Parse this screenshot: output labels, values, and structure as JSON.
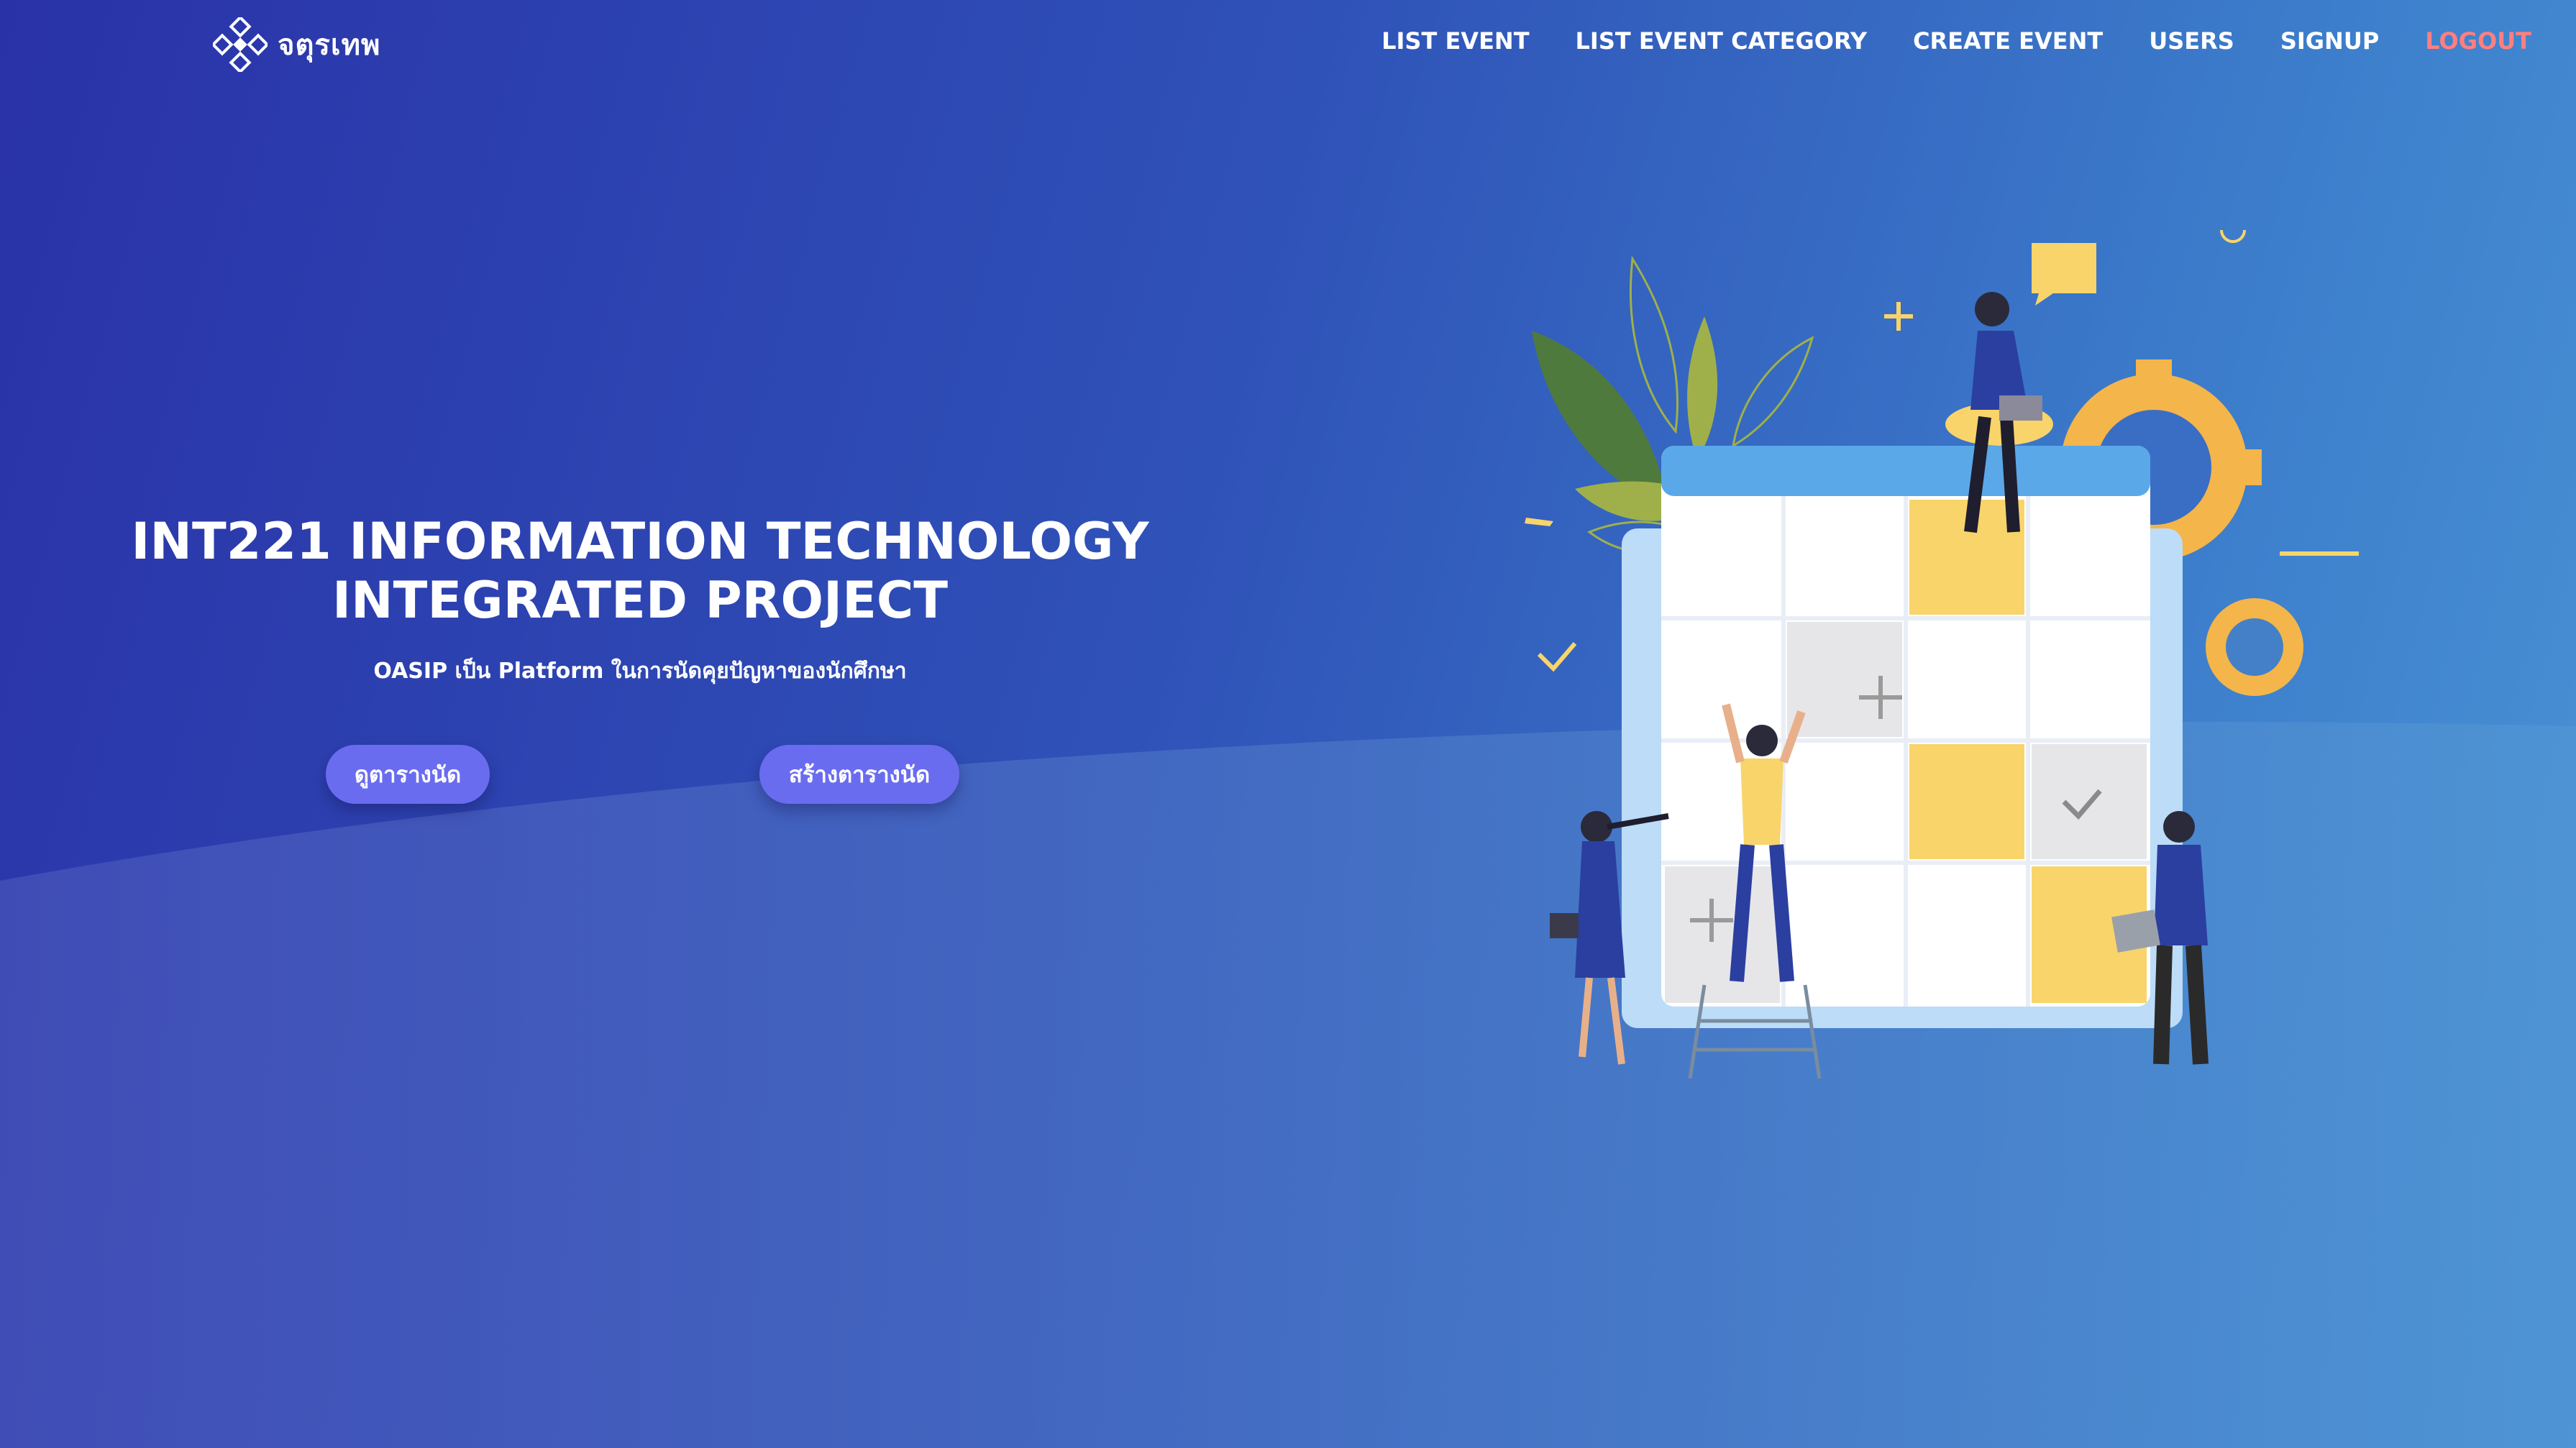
{
  "brand": {
    "name": "จตุรเทพ",
    "logo_icon": "diamond-pattern-logo"
  },
  "nav": {
    "items": [
      {
        "label": "LIST EVENT"
      },
      {
        "label": "LIST EVENT CATEGORY"
      },
      {
        "label": "CREATE EVENT"
      },
      {
        "label": "USERS"
      },
      {
        "label": "SIGNUP"
      },
      {
        "label": "LOGOUT"
      }
    ]
  },
  "hero": {
    "title_line1": "INT221 INFORMATION TECHNOLOGY",
    "title_line2": "INTEGRATED PROJECT",
    "subtitle": "OASIP เป็น Platform ในการนัดคุยปัญหาของนักศึกษา",
    "btn_view": "ดูตารางนัด",
    "btn_create": "สร้างตารางนัด"
  },
  "colors": {
    "bg_start": "#2a32a8",
    "bg_end": "#4a94d6",
    "button": "#6a6cf0",
    "logout": "#ff7f7f",
    "gear": "#f4b54a",
    "sticky": "#f8d46a"
  }
}
